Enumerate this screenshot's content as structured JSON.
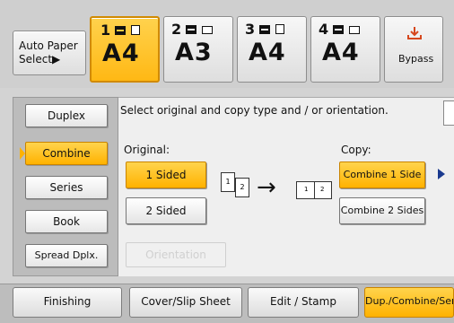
{
  "paper": {
    "auto_select": {
      "line1": "Auto Paper",
      "line2": "Select▶"
    },
    "trays": [
      {
        "num": "1",
        "size": "A4",
        "selected": true
      },
      {
        "num": "2",
        "size": "A3",
        "selected": false
      },
      {
        "num": "3",
        "size": "A4",
        "selected": false
      },
      {
        "num": "4",
        "size": "A4",
        "selected": false
      }
    ],
    "bypass": {
      "label": "Bypass"
    }
  },
  "left_menu": [
    {
      "label": "Duplex",
      "selected": false
    },
    {
      "label": "Combine",
      "selected": true
    },
    {
      "label": "Series",
      "selected": false
    },
    {
      "label": "Book",
      "selected": false
    },
    {
      "label": "Spread Dplx.",
      "selected": false
    }
  ],
  "main": {
    "instruction": "Select original and copy type and / or orientation.",
    "original_label": "Original:",
    "copy_label": "Copy:",
    "original_options": [
      {
        "label": "1 Sided",
        "selected": true
      },
      {
        "label": "2 Sided",
        "selected": false
      }
    ],
    "copy_options": [
      {
        "label": "Combine 1 Side",
        "selected": true
      },
      {
        "label": "Combine 2 Sides",
        "selected": false
      }
    ],
    "doc_pages": [
      "1",
      "2"
    ],
    "disabled_button": "Orientation",
    "arrow": "→"
  },
  "bottom_tabs": [
    {
      "label": "Finishing",
      "selected": false
    },
    {
      "label": "Cover/Slip Sheet",
      "selected": false
    },
    {
      "label": "Edit / Stamp",
      "selected": false
    },
    {
      "label": "Dup./Combine/Ser",
      "selected": true
    }
  ],
  "colors": {
    "accent": "#ffb814",
    "accent_border": "#d18a00"
  }
}
